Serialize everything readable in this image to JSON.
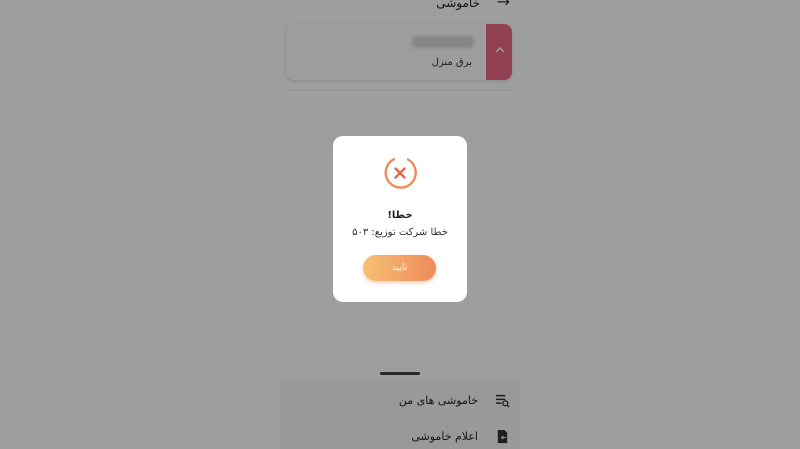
{
  "header": {
    "title": "خاموشی",
    "back_icon": "arrow-right-icon"
  },
  "card": {
    "label": "برق منزل",
    "accent_color": "#ec6a86",
    "expand_icon": "chevron-up-icon"
  },
  "bottom_menu": {
    "items": [
      {
        "label": "خاموشی های من",
        "icon": "list-search-icon"
      },
      {
        "label": "اعلام خاموشی",
        "icon": "report-icon"
      }
    ]
  },
  "dialog": {
    "icon": "error-x-icon",
    "title": "خطا!",
    "message": "خطا شرکت توزیع: ۵۰۳",
    "confirm_label": "تایید",
    "accent_color": "#ef8a5a"
  }
}
